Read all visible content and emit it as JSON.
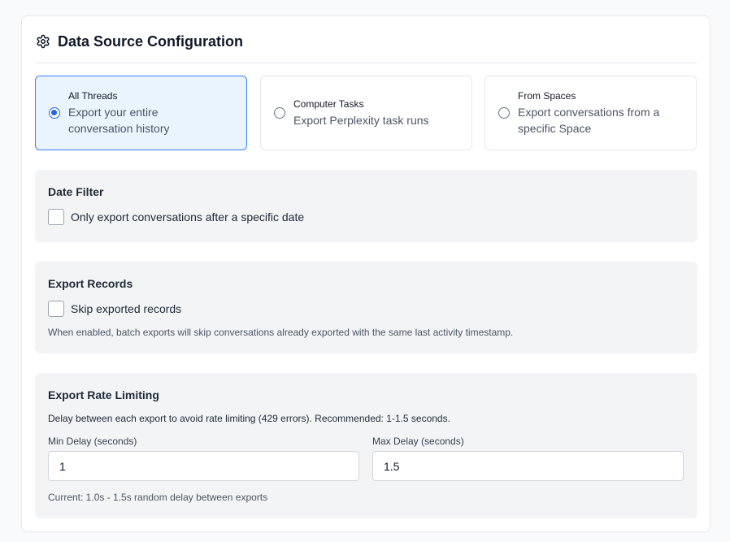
{
  "card": {
    "title": "Data Source Configuration",
    "icon": "gear-icon"
  },
  "source_options": [
    {
      "title": "All Threads",
      "desc": "Export your entire conversation history",
      "selected": true
    },
    {
      "title": "Computer Tasks",
      "desc": "Export Perplexity task runs",
      "selected": false
    },
    {
      "title": "From Spaces",
      "desc": "Export conversations from a specific Space",
      "selected": false
    }
  ],
  "date_filter": {
    "title": "Date Filter",
    "checkbox_label": "Only export conversations after a specific date",
    "checked": false
  },
  "export_records": {
    "title": "Export Records",
    "checkbox_label": "Skip exported records",
    "checked": false,
    "hint": "When enabled, batch exports will skip conversations already exported with the same last activity timestamp."
  },
  "rate_limiting": {
    "title": "Export Rate Limiting",
    "description": "Delay between each export to avoid rate limiting (429 errors). Recommended: 1-1.5 seconds.",
    "min_label": "Min Delay (seconds)",
    "min_value": "1",
    "max_label": "Max Delay (seconds)",
    "max_value": "1.5",
    "current": "Current: 1.0s - 1.5s random delay between exports"
  },
  "colors": {
    "accent": "#2563eb",
    "selected_bg": "#eaf4fe",
    "section_bg": "#f3f4f6"
  }
}
